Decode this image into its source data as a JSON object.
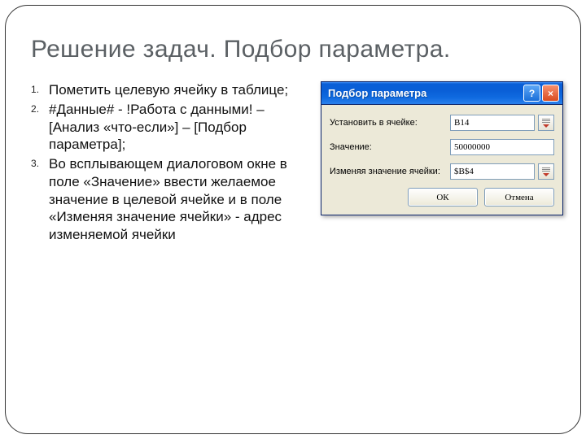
{
  "slide": {
    "heading": "Решение задач. Подбор параметра.",
    "steps": [
      "Пометить целевую ячейку в таблице;",
      "#Данные# - !Работа с данными! – [Анализ «что-если»] – [Подбор параметра];",
      "Во всплывающем диалоговом окне в поле «Значение» ввести желаемое значение в целевой ячейке и в поле «Изменяя значение ячейки» - адрес изменяемой ячейки"
    ]
  },
  "dialog": {
    "title": "Подбор параметра",
    "help_glyph": "?",
    "close_glyph": "×",
    "labels": {
      "set_cell": "Установить в ячейке:",
      "value": "Значение:",
      "changing_cell": "Изменяя значение ячейки:"
    },
    "fields": {
      "set_cell": "B14",
      "value": "50000000",
      "changing_cell": "$B$4"
    },
    "buttons": {
      "ok": "ОК",
      "cancel": "Отмена"
    }
  }
}
